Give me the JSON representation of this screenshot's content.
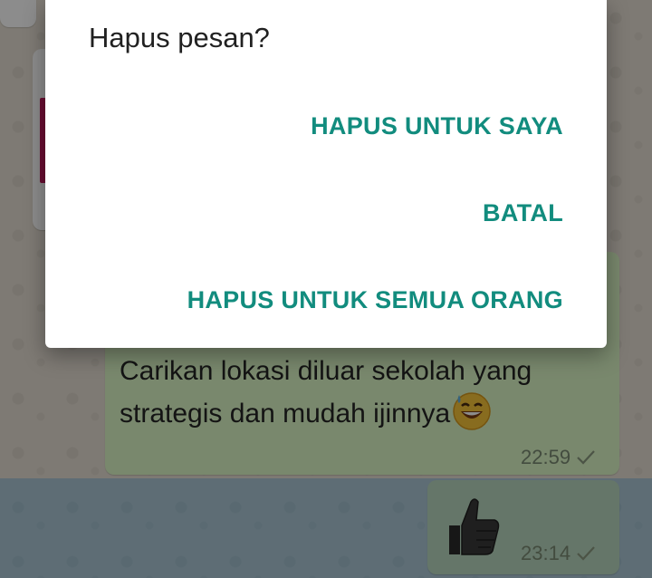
{
  "dialog": {
    "title": "Hapus pesan?",
    "actions": {
      "delete_for_me": "HAPUS UNTUK SAYA",
      "cancel": "BATAL",
      "delete_for_everyone": "HAPUS UNTUK SEMUA ORANG"
    },
    "accent_color": "#128c7e"
  },
  "chat": {
    "messages": [
      {
        "text": "Carikan lokasi diluar sekolah yang strategis dan mudah ijinnya",
        "emoji": "grinning-sweat-emoji",
        "time": "22:59",
        "status": "sent-check"
      },
      {
        "emoji": "thumbs-up-emoji",
        "time": "23:14",
        "status": "sent-check",
        "selected": true
      }
    ]
  }
}
